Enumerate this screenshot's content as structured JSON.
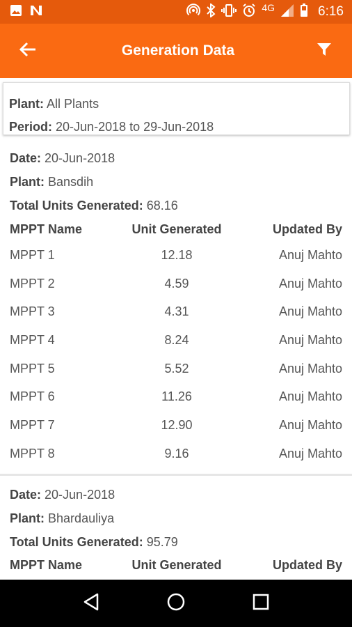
{
  "status_bar": {
    "time": "6:16",
    "network": "4G"
  },
  "app_bar": {
    "title": "Generation Data",
    "icons": [
      "back-arrow-icon",
      "filter-icon"
    ]
  },
  "summary": {
    "plant_label": "Plant:",
    "plant_value": "All Plants",
    "period_label": "Period:",
    "period_value": "20-Jun-2018 to 29-Jun-2018"
  },
  "blocks": [
    {
      "date_label": "Date:",
      "date": "20-Jun-2018",
      "plant_label": "Plant:",
      "plant": "Bansdih",
      "total_label": "Total Units Generated:",
      "total": "68.16",
      "columns": [
        "MPPT Name",
        "Unit Generated",
        "Updated By"
      ],
      "rows": [
        [
          "MPPT 1",
          "12.18",
          "Anuj Mahto"
        ],
        [
          "MPPT 2",
          "4.59",
          "Anuj Mahto"
        ],
        [
          "MPPT 3",
          "4.31",
          "Anuj Mahto"
        ],
        [
          "MPPT 4",
          "8.24",
          "Anuj Mahto"
        ],
        [
          "MPPT 5",
          "5.52",
          "Anuj Mahto"
        ],
        [
          "MPPT 6",
          "11.26",
          "Anuj Mahto"
        ],
        [
          "MPPT 7",
          "12.90",
          "Anuj Mahto"
        ],
        [
          "MPPT 8",
          "9.16",
          "Anuj Mahto"
        ]
      ]
    },
    {
      "date_label": "Date:",
      "date": "20-Jun-2018",
      "plant_label": "Plant:",
      "plant": "Bhardauliya",
      "total_label": "Total Units Generated:",
      "total": "95.79",
      "columns": [
        "MPPT Name",
        "Unit Generated",
        "Updated By"
      ],
      "rows": []
    }
  ],
  "colors": {
    "status_bar": "#e55a0c",
    "app_bar": "#fa6a12",
    "nav_bar": "#000000"
  }
}
